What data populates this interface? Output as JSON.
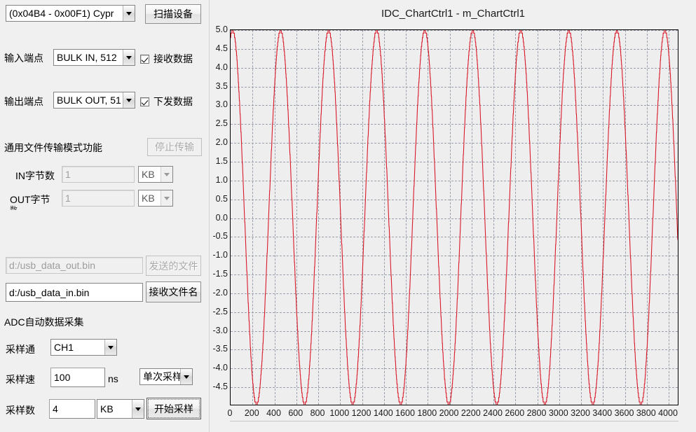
{
  "window": {
    "background": "#f0f0f0"
  },
  "device_panel": {
    "device_combo": {
      "value": "(0x04B4 - 0x00F1) Cypr",
      "caret_icon": "chevron-down-icon"
    },
    "scan_button": "扫描设备"
  },
  "endpoints": {
    "in_label": "输入端点",
    "in_combo": "BULK IN, 512",
    "in_checkbox_label": "接收数据",
    "in_checked": true,
    "out_label": "输出端点",
    "out_combo": "BULK OUT, 51",
    "out_checkbox_label": "下发数据",
    "out_checked": true
  },
  "file_transfer": {
    "group_label": "通用文件传输模式功能",
    "stop_button": "停止传输",
    "stop_enabled": false,
    "in_bytes_label": "IN字节数",
    "in_bytes_value": "1",
    "in_bytes_unit": "KB",
    "out_bytes_label": "OUT字节",
    "out_bytes_label_clipped": "数",
    "out_bytes_value": "1",
    "out_bytes_unit": "KB"
  },
  "files": {
    "send_path_value": "d:/usb_data_out.bin",
    "send_button": "发送的文件",
    "send_enabled": false,
    "recv_path_value": "d:/usb_data_in.bin",
    "recv_button": "接收文件名"
  },
  "adc": {
    "group_label": "ADC自动数据采集",
    "channel_label": "采样通",
    "channel_value": "CH1",
    "rate_label": "采样速",
    "rate_value": "100",
    "rate_unit": "ns",
    "mode_value": "单次采样",
    "count_label": "采样数",
    "count_value": "4",
    "count_unit": "KB",
    "start_button": "开始采样"
  },
  "chart": {
    "title": "IDC_ChartCtrl1 - m_ChartCtrl1",
    "line_color": "#d91a2a",
    "plot_bg": "#eeeeee",
    "grid_color": "#9aa0ab"
  },
  "chart_data": {
    "type": "line",
    "title": "IDC_ChartCtrl1 - m_ChartCtrl1",
    "xlabel": "",
    "ylabel": "",
    "xlim": [
      0,
      4096
    ],
    "ylim": [
      -5.0,
      5.0
    ],
    "grid": true,
    "legend": null,
    "xticks": [
      0,
      200,
      400,
      600,
      800,
      1000,
      1200,
      1400,
      1600,
      1800,
      2000,
      2200,
      2400,
      2600,
      2800,
      3000,
      3200,
      3400,
      3600,
      3800,
      4000
    ],
    "yticks": [
      5.0,
      4.5,
      4.0,
      3.5,
      3.0,
      2.5,
      2.0,
      1.5,
      1.0,
      0.5,
      0.0,
      -0.5,
      -1.0,
      -1.5,
      -2.0,
      -2.5,
      -3.0,
      -3.5,
      -4.0,
      -4.5
    ],
    "ytick_labels": [
      "5.0",
      "4.5",
      "4.0",
      "3.5",
      "3.0",
      "2.5",
      "2.0",
      "1.5",
      "1.0",
      "0.5",
      "0.0",
      "-0.5",
      "-1.0",
      "-1.5",
      "-2.0",
      "-2.5",
      "-3.0",
      "-3.5",
      "-4.0",
      "-4.5"
    ],
    "series": [
      {
        "name": "m_ChartCtrl1",
        "color": "#d91a2a",
        "waveform": "sine",
        "amplitude": 5.0,
        "offset": 0.0,
        "period": 440,
        "phase_deg": 75,
        "samples": 4096,
        "step_quantization": 0.12
      }
    ]
  }
}
